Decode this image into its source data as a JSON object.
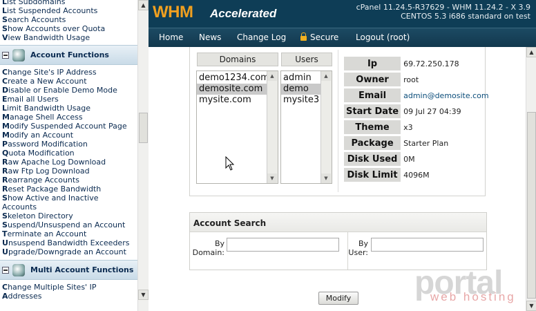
{
  "sidebar": {
    "links_top": [
      {
        "first": "L",
        "rest": "ist Subdomains"
      },
      {
        "first": "L",
        "rest": "ist Suspended Accounts"
      },
      {
        "first": "S",
        "rest": "earch Accounts"
      },
      {
        "first": "S",
        "rest": "how Accounts over Quota"
      },
      {
        "first": "V",
        "rest": "iew Bandwidth Usage"
      }
    ],
    "section_account_functions": "Account Functions",
    "account_links": [
      {
        "first": "C",
        "rest": "hange Site's IP Address"
      },
      {
        "first": "C",
        "rest": "reate a New Account"
      },
      {
        "first": "D",
        "rest": "isable or Enable Demo Mode"
      },
      {
        "first": "E",
        "rest": "mail all Users"
      },
      {
        "first": "L",
        "rest": "imit Bandwidth Usage"
      },
      {
        "first": "M",
        "rest": "anage Shell Access"
      },
      {
        "first": "M",
        "rest": "odify Suspended Account Page"
      },
      {
        "first": "M",
        "rest": "odify an Account"
      },
      {
        "first": "P",
        "rest": "assword Modification"
      },
      {
        "first": "Q",
        "rest": "uota Modification"
      },
      {
        "first": "R",
        "rest": "aw Apache Log Download"
      },
      {
        "first": "R",
        "rest": "aw Ftp Log Download"
      },
      {
        "first": "R",
        "rest": "earrange Accounts"
      },
      {
        "first": "R",
        "rest": "eset Package Bandwidth"
      },
      {
        "first": "S",
        "rest": "how Active and Inactive"
      },
      {
        "first": "",
        "rest": "Accounts"
      },
      {
        "first": "S",
        "rest": "keleton Directory"
      },
      {
        "first": "S",
        "rest": "uspend/Unsuspend an Account"
      },
      {
        "first": "T",
        "rest": "erminate an Account"
      },
      {
        "first": "U",
        "rest": "nsuspend Bandwidth Exceeders"
      },
      {
        "first": "U",
        "rest": "pgrade/Downgrade an Account"
      }
    ],
    "section_multi_account": "Multi Account Functions",
    "multi_links": [
      {
        "first": "C",
        "rest": "hange Multiple Sites' IP"
      },
      {
        "first": "A",
        "rest": "ddresses"
      }
    ]
  },
  "header": {
    "logo_main": "WHM",
    "logo_sub": "Accelerated",
    "version_line1": "cPanel 11.24.5-R37629 - WHM 11.24.2 - X 3.9",
    "version_line2": "CENTOS 5.3 i686 standard on test"
  },
  "nav": {
    "home": "Home",
    "news": "News",
    "changelog": "Change Log",
    "secure": "Secure",
    "logout": "Logout (root)"
  },
  "domains": {
    "header": "Domains",
    "items": [
      "demo1234.com",
      "demosite.com",
      "mysite.com"
    ],
    "selected_index": 1
  },
  "users": {
    "header": "Users",
    "items": [
      "admin",
      "demo",
      "mysite3"
    ],
    "selected_index": 1
  },
  "account_info": [
    {
      "label": "Ip",
      "value": "69.72.250.178"
    },
    {
      "label": "Owner",
      "value": "root"
    },
    {
      "label": "Email",
      "value": "admin@demosite.com"
    },
    {
      "label": "Start Date",
      "value": "09 Jul 27 04:39"
    },
    {
      "label": "Theme",
      "value": "x3"
    },
    {
      "label": "Package",
      "value": "Starter Plan"
    },
    {
      "label": "Disk Used",
      "value": "0M"
    },
    {
      "label": "Disk Limit",
      "value": "4096M"
    }
  ],
  "account_search": {
    "title": "Account Search",
    "by_domain_label_1": "By",
    "by_domain_label_2": "Domain:",
    "by_user_label_1": "By",
    "by_user_label_2": "User:",
    "domain_value": "",
    "user_value": ""
  },
  "modify_button": "Modify",
  "watermark": {
    "main": "portal",
    "sub": "web hosting"
  }
}
